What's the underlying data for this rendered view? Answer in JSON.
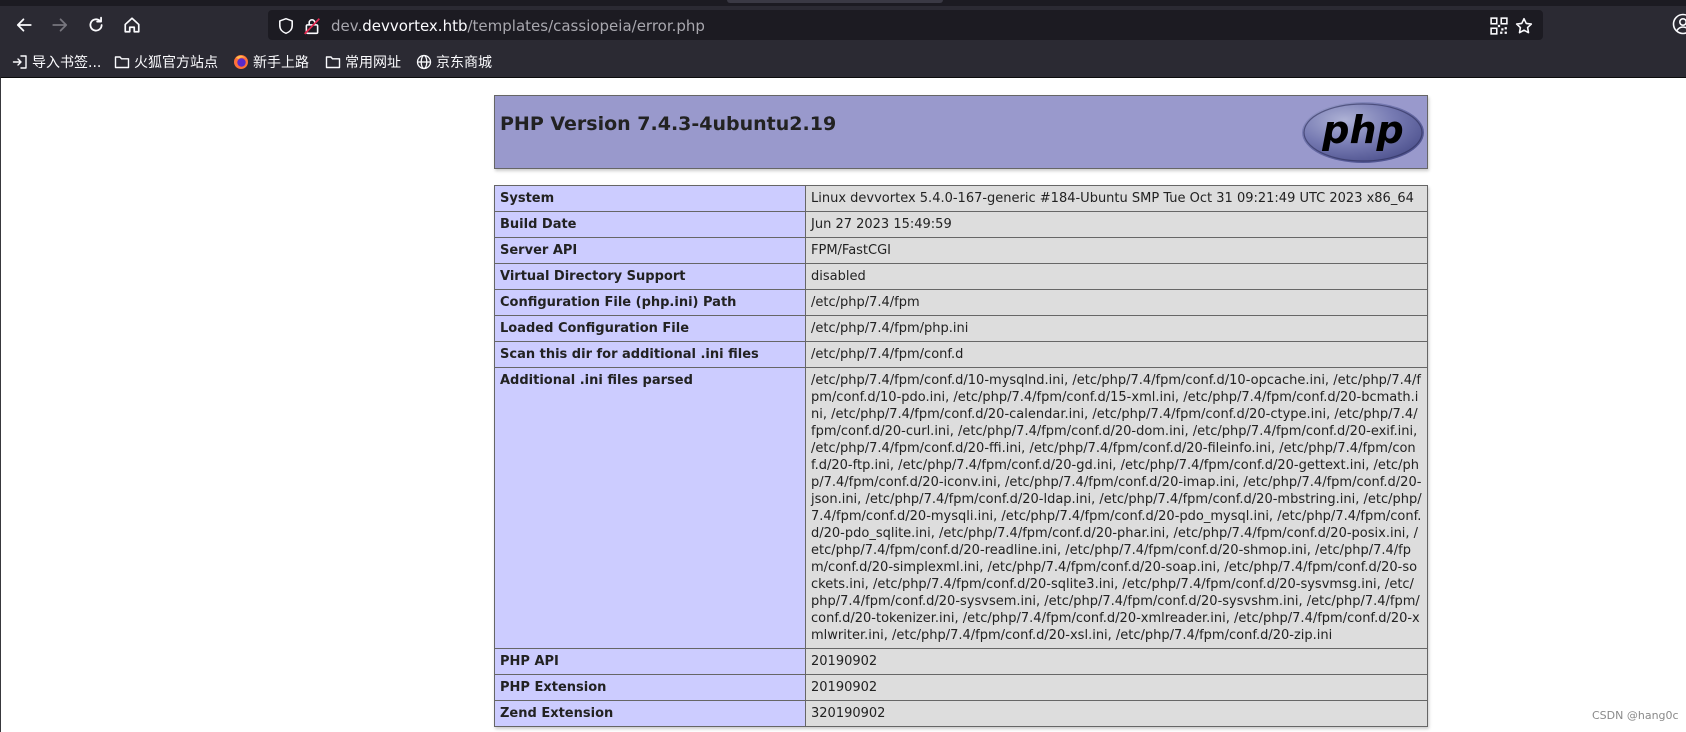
{
  "browser": {
    "url_host_prefix": "dev.",
    "url_host": "devvortex.htb",
    "url_path": "/templates/cassiopeia/error.php",
    "bookmarks": [
      {
        "label": "导入书签...",
        "icon": "import-icon"
      },
      {
        "label": "火狐官方站点",
        "icon": "folder-icon"
      },
      {
        "label": "新手上路",
        "icon": "firefox-icon"
      },
      {
        "label": "常用网址",
        "icon": "folder-icon"
      },
      {
        "label": "京东商城",
        "icon": "globe-icon"
      }
    ]
  },
  "phpinfo": {
    "title": "PHP Version 7.4.3-4ubuntu2.19",
    "logo_text": "php",
    "rows": [
      {
        "key": "System",
        "value": "Linux devvortex 5.4.0-167-generic #184-Ubuntu SMP Tue Oct 31 09:21:49 UTC 2023 x86_64"
      },
      {
        "key": "Build Date",
        "value": "Jun 27 2023 15:49:59"
      },
      {
        "key": "Server API",
        "value": "FPM/FastCGI"
      },
      {
        "key": "Virtual Directory Support",
        "value": "disabled"
      },
      {
        "key": "Configuration File (php.ini) Path",
        "value": "/etc/php/7.4/fpm"
      },
      {
        "key": "Loaded Configuration File",
        "value": "/etc/php/7.4/fpm/php.ini"
      },
      {
        "key": "Scan this dir for additional .ini files",
        "value": "/etc/php/7.4/fpm/conf.d"
      },
      {
        "key": "Additional .ini files parsed",
        "value": "/etc/php/7.4/fpm/conf.d/10-mysqlnd.ini, /etc/php/7.4/fpm/conf.d/10-opcache.ini, /etc/php/7.4/fpm/conf.d/10-pdo.ini, /etc/php/7.4/fpm/conf.d/15-xml.ini, /etc/php/7.4/fpm/conf.d/20-bcmath.ini, /etc/php/7.4/fpm/conf.d/20-calendar.ini, /etc/php/7.4/fpm/conf.d/20-ctype.ini, /etc/php/7.4/fpm/conf.d/20-curl.ini, /etc/php/7.4/fpm/conf.d/20-dom.ini, /etc/php/7.4/fpm/conf.d/20-exif.ini, /etc/php/7.4/fpm/conf.d/20-ffi.ini, /etc/php/7.4/fpm/conf.d/20-fileinfo.ini, /etc/php/7.4/fpm/conf.d/20-ftp.ini, /etc/php/7.4/fpm/conf.d/20-gd.ini, /etc/php/7.4/fpm/conf.d/20-gettext.ini, /etc/php/7.4/fpm/conf.d/20-iconv.ini, /etc/php/7.4/fpm/conf.d/20-imap.ini, /etc/php/7.4/fpm/conf.d/20-json.ini, /etc/php/7.4/fpm/conf.d/20-ldap.ini, /etc/php/7.4/fpm/conf.d/20-mbstring.ini, /etc/php/7.4/fpm/conf.d/20-mysqli.ini, /etc/php/7.4/fpm/conf.d/20-pdo_mysql.ini, /etc/php/7.4/fpm/conf.d/20-pdo_sqlite.ini, /etc/php/7.4/fpm/conf.d/20-phar.ini, /etc/php/7.4/fpm/conf.d/20-posix.ini, /etc/php/7.4/fpm/conf.d/20-readline.ini, /etc/php/7.4/fpm/conf.d/20-shmop.ini, /etc/php/7.4/fpm/conf.d/20-simplexml.ini, /etc/php/7.4/fpm/conf.d/20-soap.ini, /etc/php/7.4/fpm/conf.d/20-sockets.ini, /etc/php/7.4/fpm/conf.d/20-sqlite3.ini, /etc/php/7.4/fpm/conf.d/20-sysvmsg.ini, /etc/php/7.4/fpm/conf.d/20-sysvsem.ini, /etc/php/7.4/fpm/conf.d/20-sysvshm.ini, /etc/php/7.4/fpm/conf.d/20-tokenizer.ini, /etc/php/7.4/fpm/conf.d/20-xmlreader.ini, /etc/php/7.4/fpm/conf.d/20-xmlwriter.ini, /etc/php/7.4/fpm/conf.d/20-xsl.ini, /etc/php/7.4/fpm/conf.d/20-zip.ini"
      },
      {
        "key": "PHP API",
        "value": "20190902"
      },
      {
        "key": "PHP Extension",
        "value": "20190902"
      },
      {
        "key": "Zend Extension",
        "value": "320190902"
      }
    ]
  },
  "watermark": "CSDN @hang0c",
  "colors": {
    "header_bg": "#9999cc",
    "key_bg": "#ccccff",
    "value_bg": "#dddddd",
    "chrome_bg": "#2b2a33"
  }
}
